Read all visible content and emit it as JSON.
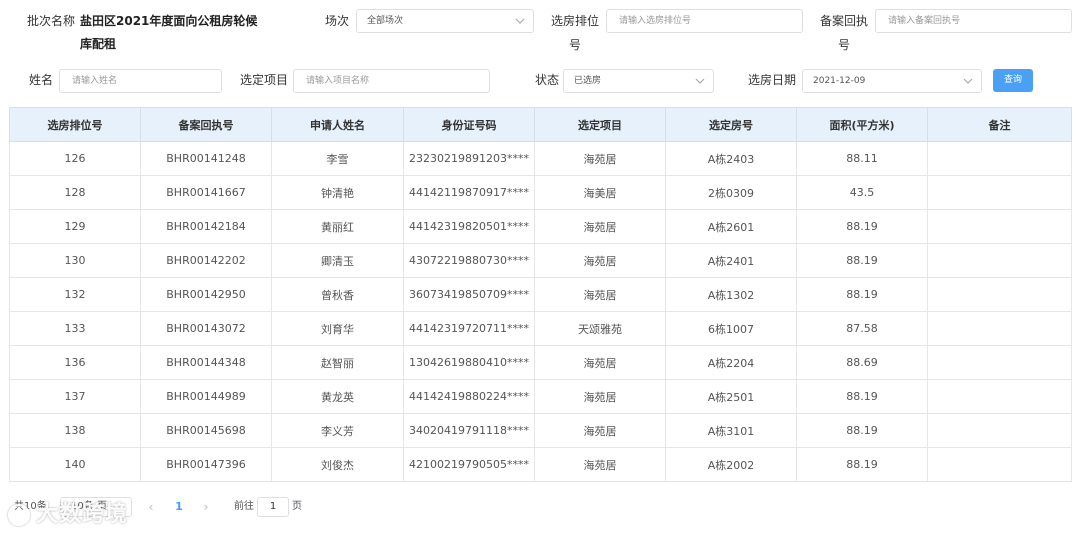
{
  "filters": {
    "batch_label": "批次名称",
    "batch_value": "盐田区2021年度面向公租房轮候库配租",
    "session_label": "场次",
    "session_value": "全部场次",
    "rank_label": "选房排位号",
    "rank_placeholder": "请输入选房排位号",
    "receipt_label": "备案回执号",
    "receipt_placeholder": "请输入备案回执号",
    "name_label": "姓名",
    "name_placeholder": "请输入姓名",
    "project_label": "选定项目",
    "project_placeholder": "请输入项目名称",
    "status_label": "状态",
    "status_value": "已选房",
    "date_label": "选房日期",
    "date_value": "2021-12-09",
    "query_button": "查询"
  },
  "table": {
    "headers": [
      "选房排位号",
      "备案回执号",
      "申请人姓名",
      "身份证号码",
      "选定项目",
      "选定房号",
      "面积(平方米)",
      "备注"
    ],
    "rows": [
      [
        "126",
        "BHR00141248",
        "李雪",
        "23230219891203****",
        "海苑居",
        "A栋2403",
        "88.11",
        ""
      ],
      [
        "128",
        "BHR00141667",
        "钟清艳",
        "44142119870917****",
        "海美居",
        "2栋0309",
        "43.5",
        ""
      ],
      [
        "129",
        "BHR00142184",
        "黄丽红",
        "44142319820501****",
        "海苑居",
        "A栋2601",
        "88.19",
        ""
      ],
      [
        "130",
        "BHR00142202",
        "卿清玉",
        "43072219880730****",
        "海苑居",
        "A栋2401",
        "88.19",
        ""
      ],
      [
        "132",
        "BHR00142950",
        "曾秋香",
        "36073419850709****",
        "海苑居",
        "A栋1302",
        "88.19",
        ""
      ],
      [
        "133",
        "BHR00143072",
        "刘育华",
        "44142319720711****",
        "天颂雅苑",
        "6栋1007",
        "87.58",
        ""
      ],
      [
        "136",
        "BHR00144348",
        "赵智丽",
        "13042619880410****",
        "海苑居",
        "A栋2204",
        "88.69",
        ""
      ],
      [
        "137",
        "BHR00144989",
        "黄龙英",
        "44142419880224****",
        "海苑居",
        "A栋2501",
        "88.19",
        ""
      ],
      [
        "138",
        "BHR00145698",
        "李义芳",
        "34020419791118****",
        "海苑居",
        "A栋3101",
        "88.19",
        ""
      ],
      [
        "140",
        "BHR00147396",
        "刘俊杰",
        "42100219790505****",
        "海苑居",
        "A栋2002",
        "88.19",
        ""
      ]
    ]
  },
  "pagination": {
    "total_label": "共10条",
    "page_size": "10条/页",
    "current_page": "1",
    "goto_label": "前往",
    "goto_value": "1",
    "page_suffix": "页"
  },
  "watermark": {
    "text": "大数跨境"
  },
  "colors": {
    "accent": "#409eff",
    "button": "#4aa0f5",
    "header_bg": "#e6f1fc"
  }
}
